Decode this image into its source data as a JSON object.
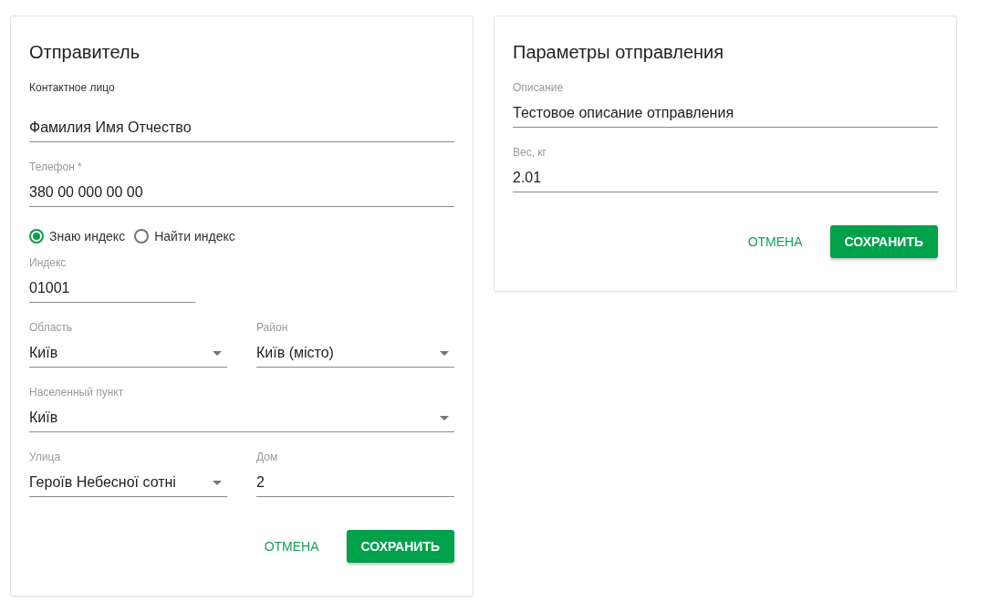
{
  "cards": [
    {
      "title": "Отправитель",
      "rows": [
        {
          "kind": "single",
          "fields": [
            {
              "kind": "plain",
              "label": "Контактное лицо",
              "value": "Фамилия Имя Отчество"
            }
          ]
        },
        {
          "kind": "single",
          "fields": [
            {
              "kind": "text",
              "label": "Телефон *",
              "value": "380 00 000 00 00"
            }
          ]
        },
        {
          "kind": "radio",
          "options": [
            {
              "label": "Знаю индекс",
              "selected": true
            },
            {
              "label": "Найти индекс",
              "selected": false
            }
          ]
        },
        {
          "kind": "short",
          "fields": [
            {
              "kind": "text",
              "label": "Индекс",
              "value": "01001"
            }
          ]
        },
        {
          "kind": "pair",
          "fields": [
            {
              "kind": "select",
              "label": "Область",
              "value": "Київ"
            },
            {
              "kind": "select",
              "label": "Район",
              "value": "Київ (місто)"
            }
          ]
        },
        {
          "kind": "single",
          "fields": [
            {
              "kind": "select",
              "label": "Населенный пункт",
              "value": "Київ"
            }
          ]
        },
        {
          "kind": "pair",
          "fields": [
            {
              "kind": "select",
              "label": "Улица",
              "value": "Героїв Небесної сотні"
            },
            {
              "kind": "text",
              "label": "Дом",
              "value": "2"
            }
          ]
        }
      ],
      "buttons": [
        {
          "kind": "text",
          "label": "ОТМЕНА"
        },
        {
          "kind": "primary",
          "label": "СОХРАНИТЬ"
        }
      ]
    },
    {
      "title": "Параметры отправления",
      "rows": [
        {
          "kind": "single",
          "fields": [
            {
              "kind": "text",
              "label": "Описание",
              "value": "Тестовое описание отправления"
            }
          ]
        },
        {
          "kind": "single",
          "fields": [
            {
              "kind": "text",
              "label": "Вес, кг",
              "value": "2.01"
            }
          ]
        }
      ],
      "buttons": [
        {
          "kind": "text",
          "label": "ОТМЕНА"
        },
        {
          "kind": "primary",
          "label": "СОХРАНИТЬ"
        }
      ]
    }
  ]
}
